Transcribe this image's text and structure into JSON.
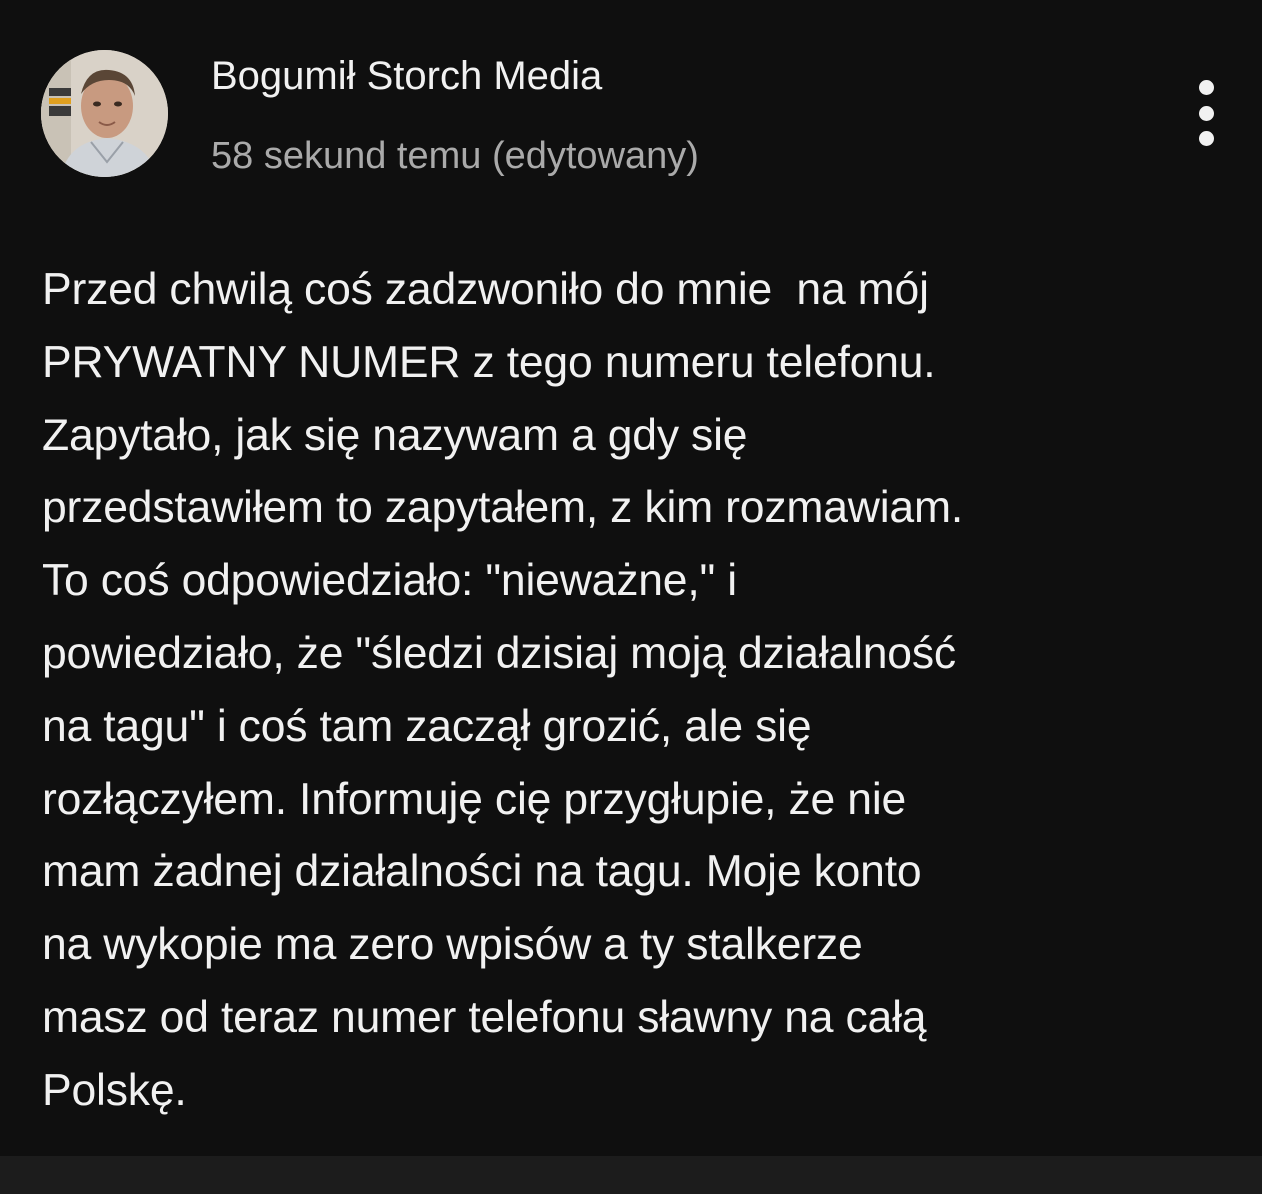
{
  "post": {
    "author": {
      "name": "Bogumił Storch Media",
      "avatar": "author-avatar-photo"
    },
    "timestamp": "58 sekund temu (edytowany)",
    "more_menu_icon": "vertical-ellipsis-icon",
    "body_lines": [
      "Przed chwilą coś zadzwoniło do mnie  na mój",
      "PRYWATNY NUMER z tego numeru telefonu.",
      "Zapytało, jak się nazywam a gdy się",
      "przedstawiłem to zapytałem, z kim rozmawiam.",
      "To coś odpowiedziało: \"nieważne,\" i",
      "powiedziało, że \"śledzi dzisiaj moją działalność",
      "na tagu\" i coś tam zaczął grozić, ale się",
      "rozłączyłem. Informuję cię przygłupie, że nie",
      "mam żadnej działalności na tagu. Moje konto",
      "na wykopie ma zero wpisów a ty stalkerze",
      "masz od teraz numer telefonu sławny na całą",
      "Polskę."
    ]
  },
  "colors": {
    "background": "#0f0f0f",
    "text_primary": "#f1f1f1",
    "text_secondary": "#aaaaaa",
    "bottom_bar": "#1c1c1c"
  }
}
